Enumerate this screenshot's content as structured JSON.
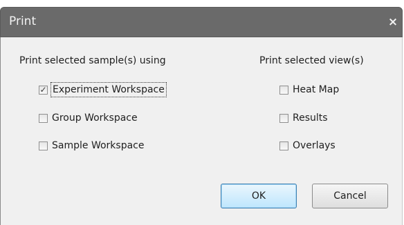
{
  "window": {
    "title": "Print",
    "close_symbol": "×"
  },
  "left_section": {
    "label": "Print selected sample(s) using",
    "options": [
      {
        "label": "Experiment Workspace",
        "checked": true
      },
      {
        "label": "Group Workspace",
        "checked": false
      },
      {
        "label": "Sample Workspace",
        "checked": false
      }
    ]
  },
  "right_section": {
    "label": "Print selected view(s)",
    "options": [
      {
        "label": "Heat Map",
        "checked": false
      },
      {
        "label": "Results",
        "checked": false
      },
      {
        "label": "Overlays",
        "checked": false
      }
    ]
  },
  "buttons": {
    "ok_label": "OK",
    "cancel_label": "Cancel"
  },
  "checkmark_symbol": "✓",
  "colors": {
    "titlebar": "#6a6a6a",
    "body": "#f0f0f0",
    "ok_accent": "#3c7fb1"
  }
}
